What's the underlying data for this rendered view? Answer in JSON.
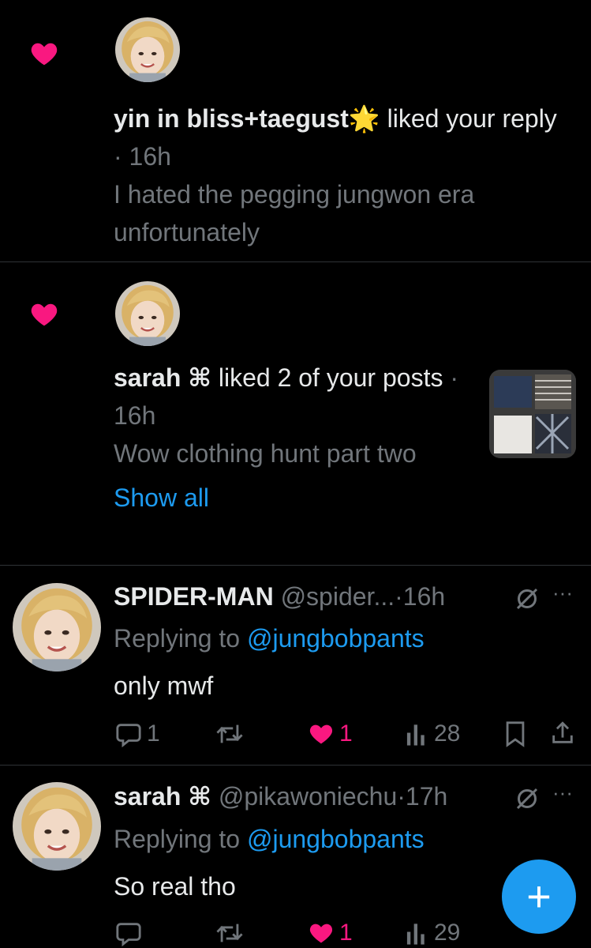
{
  "notifications": [
    {
      "user": "yin in bliss+taegust",
      "user_emoji": "🌟",
      "action": " liked your reply",
      "time": " · 16h",
      "snippet": "I hated the pegging jungwon era unfortunately"
    },
    {
      "user": "sarah ⌘",
      "action": " liked 2 of your posts",
      "time": " · 16h",
      "snippet": "Wow clothing hunt part two",
      "show_all": "Show all"
    }
  ],
  "tweets": [
    {
      "name": "SPIDER-MAN",
      "handle": "@spider...",
      "time": "·16h",
      "replying_prefix": "Replying to ",
      "replying_to": "@jungbobpants",
      "text": "only mwf",
      "reply_count": "1",
      "retweet_count": "",
      "like_count": "1",
      "views": "28"
    },
    {
      "name": "sarah ⌘",
      "handle": "@pikawoniechu",
      "time": "·17h",
      "replying_prefix": "Replying to ",
      "replying_to": "@jungbobpants",
      "text": "So real tho",
      "reply_count": "",
      "retweet_count": "",
      "like_count": "1",
      "views": "29"
    }
  ],
  "compose_button": "+",
  "colors": {
    "background": "#000000",
    "like": "#f91880",
    "link": "#1d9bf0",
    "muted": "#71767b"
  }
}
